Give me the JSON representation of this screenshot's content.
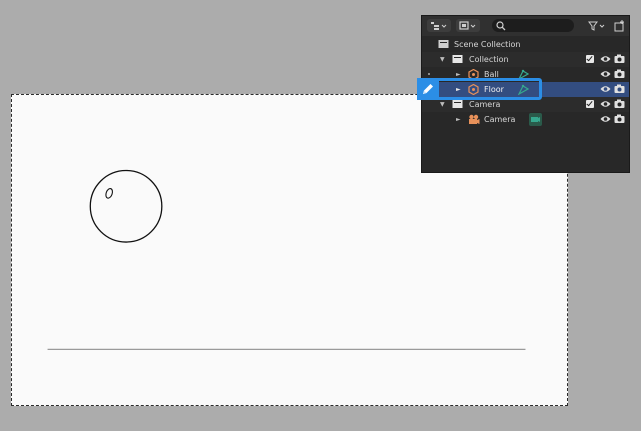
{
  "outliner": {
    "scene_label": "Scene Collection",
    "rows": [
      {
        "label": "Collection",
        "type": "collection"
      },
      {
        "label": "Ball",
        "type": "object"
      },
      {
        "label": "Floor",
        "type": "object",
        "selected": true
      },
      {
        "label": "Camera",
        "type": "collection"
      },
      {
        "label": "Camera",
        "type": "camera-object"
      }
    ],
    "header_icons": [
      "outliner-display-mode-icon",
      "view-layer-icon",
      "search-icon",
      "filter-icon",
      "new-collection-icon"
    ]
  },
  "colors": {
    "selection_highlight": "#2b8ee6",
    "row_selected": "#334d80",
    "object_icon": "#e8915a",
    "mesh_data_icon": "#36a88e"
  }
}
